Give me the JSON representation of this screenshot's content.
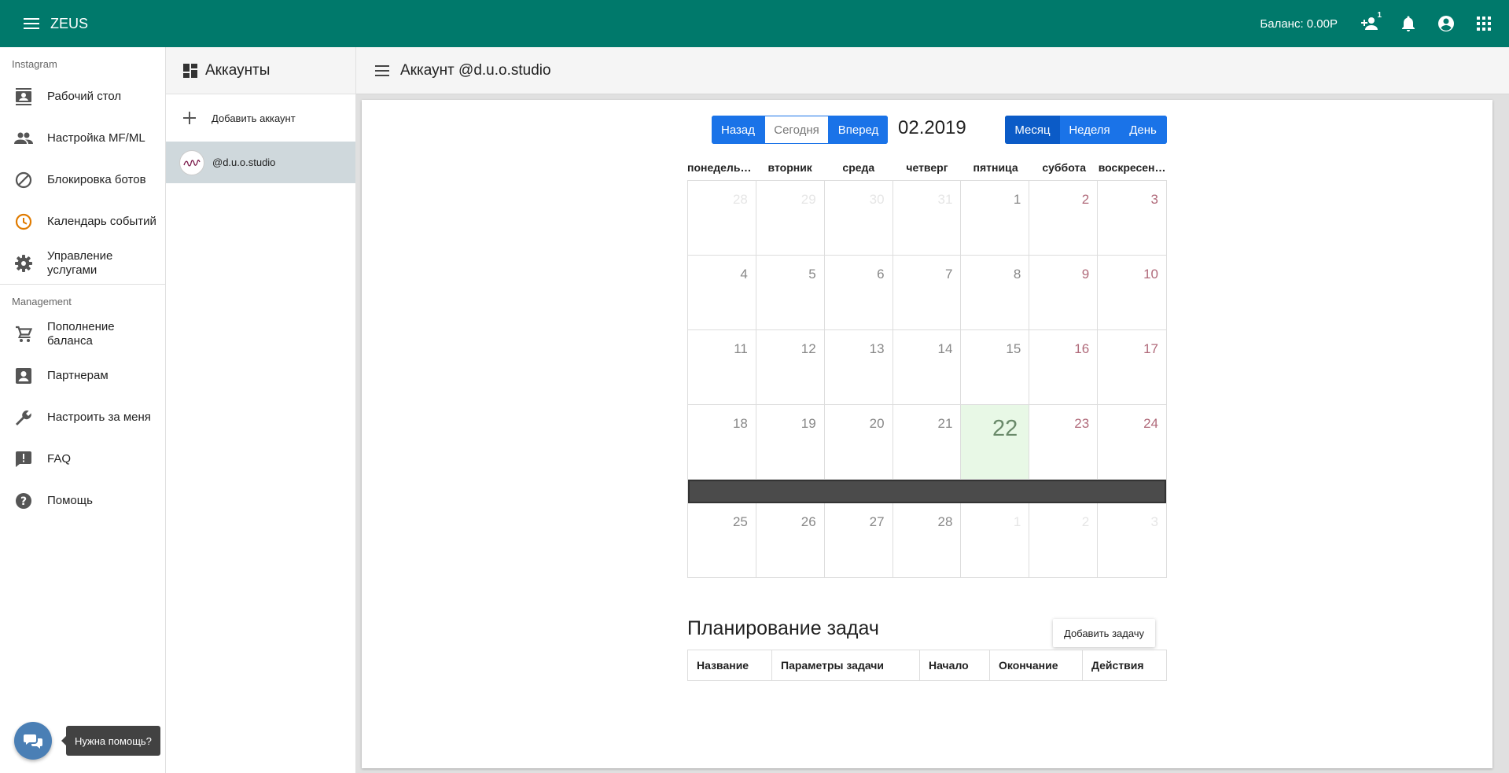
{
  "app": {
    "title": "ZEUS"
  },
  "header": {
    "balance": "Баланс: 0.00Р",
    "add_user_badge": "1"
  },
  "sidebar": {
    "section_instagram": "Instagram",
    "instagram_items": [
      {
        "label": "Рабочий стол",
        "icon": "contacts-icon"
      },
      {
        "label": "Настройка MF/ML",
        "icon": "people-icon"
      },
      {
        "label": "Блокировка ботов",
        "icon": "block-icon"
      },
      {
        "label": "Календарь событий",
        "icon": "clock-icon"
      },
      {
        "label": "Управление услугами",
        "icon": "gear-icon"
      }
    ],
    "section_management": "Management",
    "management_items": [
      {
        "label": "Пополнение баланса",
        "icon": "cart-icon"
      },
      {
        "label": "Партнерам",
        "icon": "account-box-icon"
      },
      {
        "label": "Настроить за меня",
        "icon": "wrench-icon"
      },
      {
        "label": "FAQ",
        "icon": "feedback-icon"
      },
      {
        "label": "Помощь",
        "icon": "help-icon"
      }
    ]
  },
  "accounts": {
    "title": "Аккаунты",
    "add_label": "Добавить аккаунт",
    "items": [
      {
        "name": "@d.u.o.studio"
      }
    ]
  },
  "main": {
    "title": "Аккаунт @d.u.o.studio"
  },
  "calendar": {
    "nav": {
      "prev": "Назад",
      "today": "Сегодня",
      "next": "Вперед"
    },
    "month_label": "02.2019",
    "views": {
      "month": "Месяц",
      "week": "Неделя",
      "day": "День"
    },
    "active_view": "month",
    "weekdays": [
      "понедельник",
      "вторник",
      "среда",
      "четверг",
      "пятница",
      "суббота",
      "воскресенье"
    ],
    "weeks": [
      [
        {
          "d": "28",
          "o": true
        },
        {
          "d": "29",
          "o": true
        },
        {
          "d": "30",
          "o": true
        },
        {
          "d": "31",
          "o": true
        },
        {
          "d": "1"
        },
        {
          "d": "2"
        },
        {
          "d": "3"
        }
      ],
      [
        {
          "d": "4"
        },
        {
          "d": "5"
        },
        {
          "d": "6"
        },
        {
          "d": "7"
        },
        {
          "d": "8"
        },
        {
          "d": "9"
        },
        {
          "d": "10"
        }
      ],
      [
        {
          "d": "11"
        },
        {
          "d": "12"
        },
        {
          "d": "13"
        },
        {
          "d": "14"
        },
        {
          "d": "15"
        },
        {
          "d": "16"
        },
        {
          "d": "17"
        }
      ],
      [
        {
          "d": "18"
        },
        {
          "d": "19"
        },
        {
          "d": "20"
        },
        {
          "d": "21"
        },
        {
          "d": "22",
          "today": true
        },
        {
          "d": "23"
        },
        {
          "d": "24"
        }
      ],
      [
        {
          "d": "25"
        },
        {
          "d": "26"
        },
        {
          "d": "27"
        },
        {
          "d": "28"
        },
        {
          "d": "1",
          "o": true
        },
        {
          "d": "2",
          "o": true
        },
        {
          "d": "3",
          "o": true
        }
      ]
    ]
  },
  "tasks": {
    "title": "Планирование задач",
    "add_label": "Добавить задачу",
    "columns": [
      "Название",
      "Параметры задачи",
      "Начало",
      "Окончание",
      "Действия"
    ]
  },
  "help": {
    "tooltip": "Нужна помощь?"
  },
  "colors": {
    "topbar": "#00796b",
    "accent": "#1a73e8",
    "today": "#e8f8e6",
    "clock_icon": "#e07b00"
  }
}
